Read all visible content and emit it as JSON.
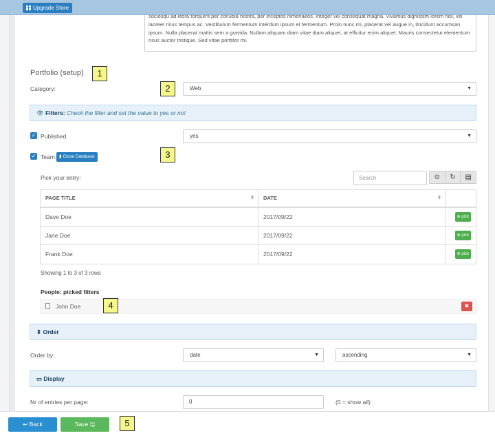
{
  "topbar": {
    "upgrade_label": "Upgrade Store",
    "upgrade_icon": "grid-icon"
  },
  "intro_text": "sociosqu ad litora torquent per conubia nostra, per inceptos himenaeos. Integer vel consequat magna. Vivamus dignissim lorem nisl, vel laoreet risus tempus ac. Vestibulum fermentum interdum ipsum et fermentum. Proin nunc mi, placerat vel augue in, tincidunt accumsan ipsum. Nulla placerat mattis sem a gravida. Nullam aliquam diam vitae diam aliquet, at efficitur enim aliquet. Mauris consectetur elementum risus auctor tristique. Sed vitae porttitor mi.",
  "portfolio": {
    "title": "Portfolio (setup)",
    "category_label": "Category:",
    "category_value": "Web",
    "filters_title": "Filters",
    "filters_note": "Check the filter and set the value to yes or no!",
    "published_label": "Published",
    "published_value": "yes",
    "team_label": "Team:",
    "close_db_label": "Close Database"
  },
  "entries": {
    "pick_label": "Pick your entry:",
    "search_placeholder": "Search",
    "columns": [
      "PAGE TITLE",
      "DATE"
    ],
    "rows": [
      {
        "title": "Dave Doe",
        "date": "2017/09/22"
      },
      {
        "title": "Jane Doe",
        "date": "2017/09/22"
      },
      {
        "title": "Frank Doe",
        "date": "2017/09/22"
      }
    ],
    "pick_button": "pick",
    "footer": "Showing 1 to 3 of 3 rows"
  },
  "people": {
    "label": "People: picked filters",
    "picked": "John Doe"
  },
  "order": {
    "title": "Order",
    "by_label": "Order by:",
    "by_value": "date",
    "direction_value": "ascending"
  },
  "display": {
    "title": "Display",
    "entries_label": "Nr of entries per page:",
    "entries_value": "0",
    "entries_hint": "(0 = show all)"
  },
  "actions": {
    "back_label": "Back",
    "save_label": "Save"
  },
  "badges": [
    "1",
    "2",
    "3",
    "4",
    "5"
  ],
  "colors": {
    "primary": "#2a7fc1",
    "success": "#5cb85c",
    "danger": "#d9534f",
    "panel": "#e6f1fa",
    "badge": "#f5f78a"
  }
}
